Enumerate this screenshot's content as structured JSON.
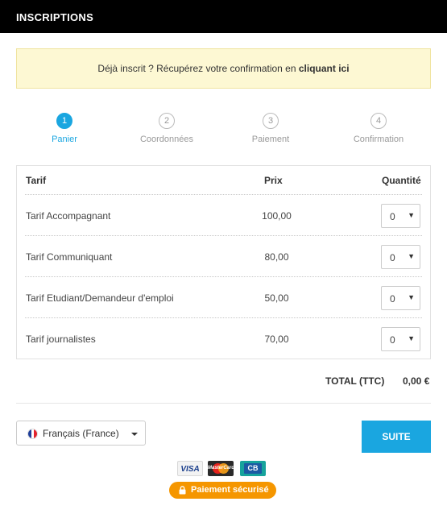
{
  "header": {
    "title": "INSCRIPTIONS"
  },
  "notice": {
    "text": "Déjà inscrit ? Récupérez votre confirmation en ",
    "link": "cliquant ici"
  },
  "steps": [
    {
      "number": "1",
      "label": "Panier",
      "active": true
    },
    {
      "number": "2",
      "label": "Coordonnées",
      "active": false
    },
    {
      "number": "3",
      "label": "Paiement",
      "active": false
    },
    {
      "number": "4",
      "label": "Confirmation",
      "active": false
    }
  ],
  "table": {
    "headers": {
      "tarif": "Tarif",
      "prix": "Prix",
      "quantite": "Quantité"
    },
    "rows": [
      {
        "name": "Tarif Accompagnant",
        "price": "100,00",
        "qty": "0"
      },
      {
        "name": "Tarif Communiquant",
        "price": "80,00",
        "qty": "0"
      },
      {
        "name": "Tarif Etudiant/Demandeur d'emploi",
        "price": "50,00",
        "qty": "0"
      },
      {
        "name": "Tarif journalistes",
        "price": "70,00",
        "qty": "0"
      }
    ]
  },
  "total": {
    "label": "TOTAL (TTC)",
    "value": "0,00 €"
  },
  "language": {
    "selected": "Français (France)"
  },
  "actions": {
    "next_label": "SUITE"
  },
  "payment": {
    "cards": {
      "visa": "VISA",
      "mastercard": "MasterCard",
      "cb": "CB"
    },
    "secure_label": "Paiement sécurisé"
  },
  "colors": {
    "accent": "#1aa6e0",
    "secure": "#f59600",
    "notice_bg": "#fdf8d3",
    "header_bg": "#000000"
  },
  "icons": {
    "lock": "lock-icon",
    "caret": "caret-down-icon",
    "flag": "flag-fr-icon"
  }
}
